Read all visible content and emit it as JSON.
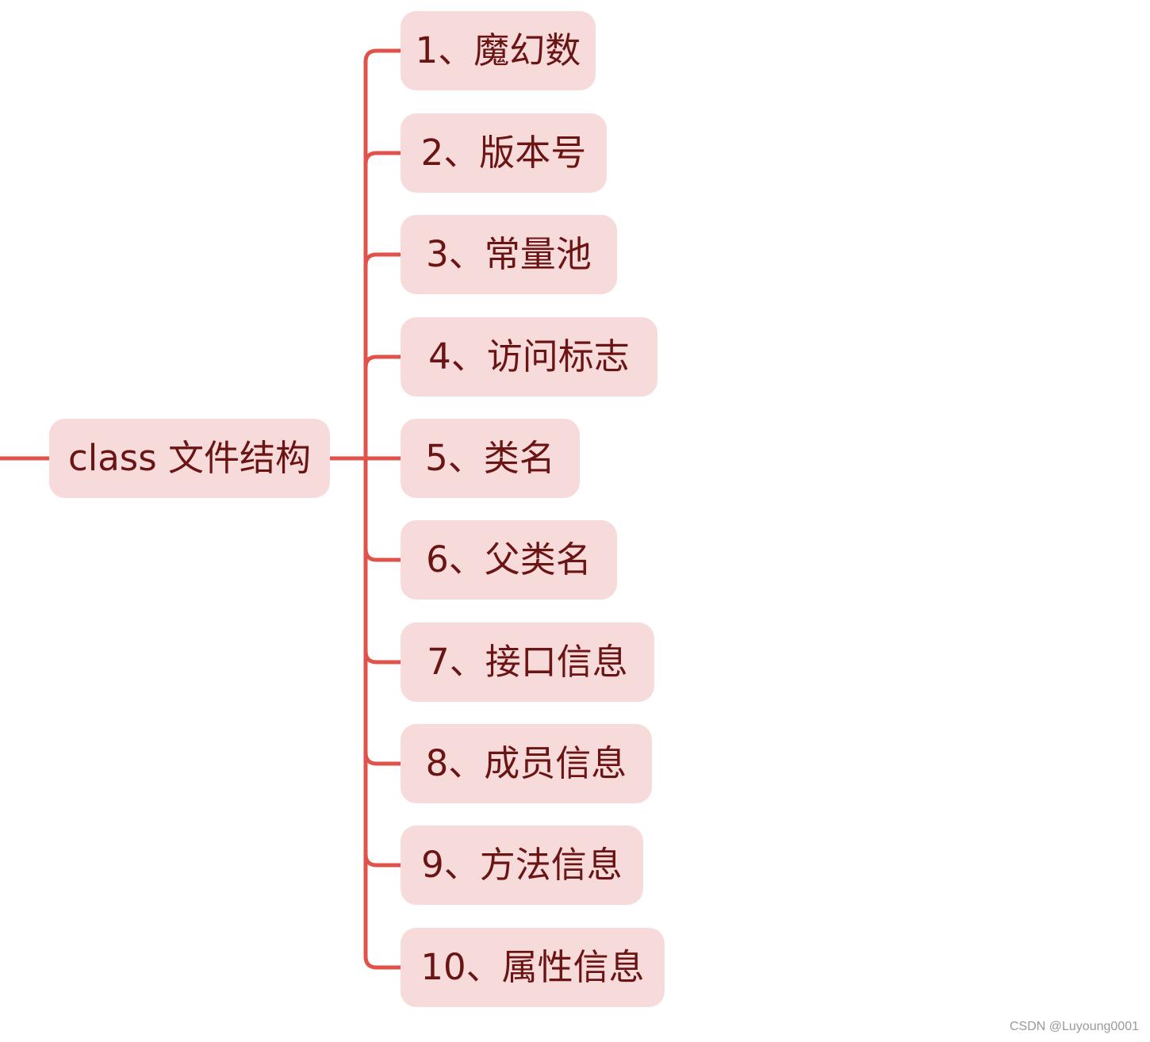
{
  "mindmap": {
    "root": {
      "label": "class 文件结构"
    },
    "branches": [
      {
        "label": "1、魔幻数"
      },
      {
        "label": "2、版本号"
      },
      {
        "label": "3、常量池"
      },
      {
        "label": "4、访问标志"
      },
      {
        "label": "5、类名"
      },
      {
        "label": "6、父类名"
      },
      {
        "label": "7、接口信息"
      },
      {
        "label": "8、成员信息"
      },
      {
        "label": "9、方法信息"
      },
      {
        "label": "10、属性信息"
      }
    ]
  },
  "colors": {
    "connector": "#e0524a",
    "node_fill": "#f7dada",
    "node_text": "#6b1414"
  },
  "watermark": "CSDN @Luyoung0001"
}
